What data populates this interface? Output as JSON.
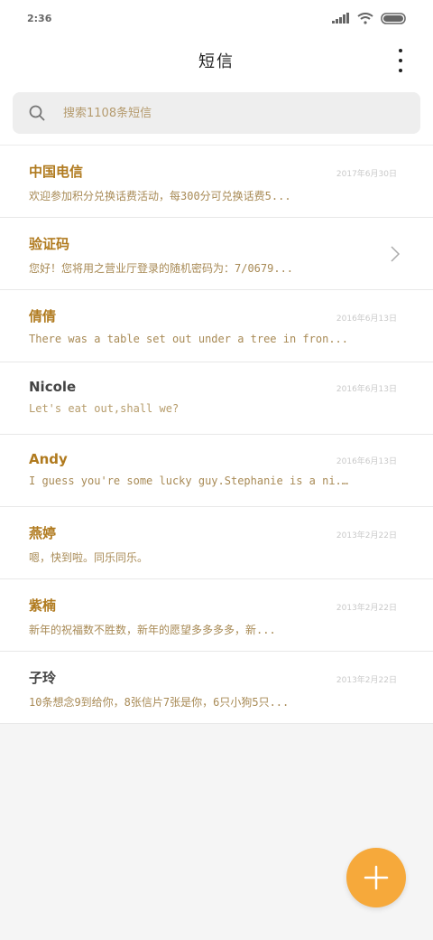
{
  "status": {
    "time": "2:36"
  },
  "header": {
    "title": "短信"
  },
  "search": {
    "placeholder": "搜索1108条短信"
  },
  "messages": [
    {
      "name": "中国电信",
      "date": "2017年6月30日",
      "preview": "欢迎参加积分兑换话费活动，每300分可兑换话费5..."
    },
    {
      "name": "验证码",
      "date": "",
      "preview": "您好！您将用之营业厅登录的随机密码为：7/0679..."
    },
    {
      "name": "倩倩",
      "date": "2016年6月13日",
      "preview": "There was a table set out under a tree in fron..."
    },
    {
      "name": "Nicole",
      "date": "2016年6月13日",
      "preview": "Let's eat out,shall we?"
    },
    {
      "name": "Andy",
      "date": "2016年6月13日",
      "preview": "I guess you're some lucky guy.Stephanie is a ni..."
    },
    {
      "name": "燕婷",
      "date": "2013年2月22日",
      "preview": "嗯，快到啦。同乐同乐。"
    },
    {
      "name": "紫楠",
      "date": "2013年2月22日",
      "preview": "新年的祝福数不胜数，新年的愿望多多多多，新..."
    },
    {
      "name": "子玲",
      "date": "2013年2月22日",
      "preview": "10条想念9到给你，8张信片7张是你，6只小狗5只..."
    }
  ],
  "colors": {
    "accent": "#f6a93b",
    "name": "#b07a1e",
    "preview": "#a88a55"
  },
  "icons": {
    "search": "search-icon",
    "menu": "more-vertical-icon",
    "chevron": "chevron-right-icon",
    "compose": "plus-icon"
  }
}
